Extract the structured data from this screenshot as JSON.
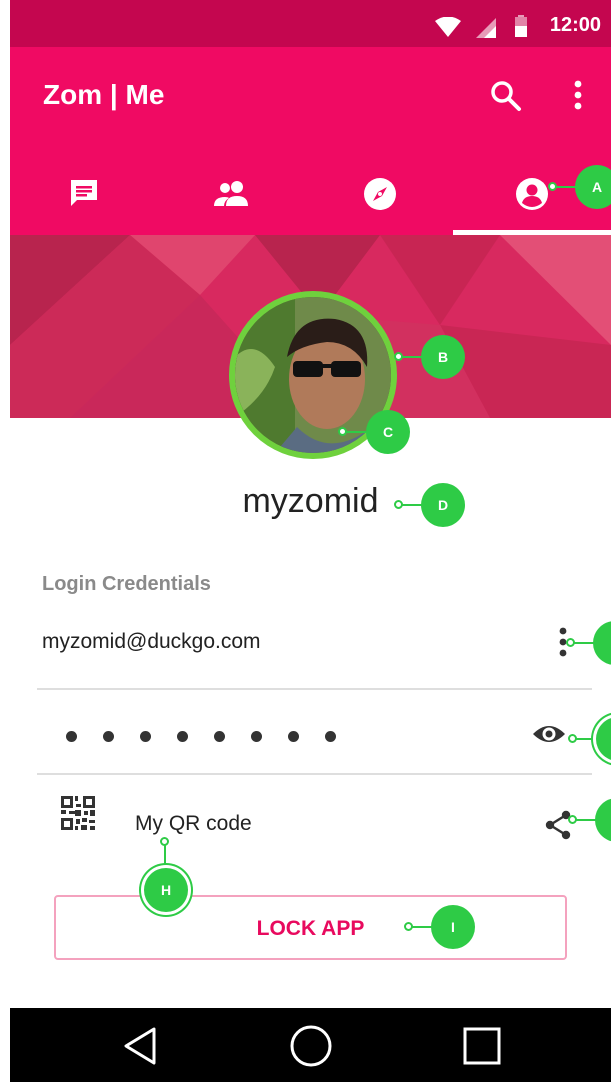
{
  "status_bar": {
    "time": "12:00"
  },
  "app_bar": {
    "title": "Zom | Me"
  },
  "tabs": [
    {
      "name": "chats",
      "icon": "chat-icon"
    },
    {
      "name": "friends",
      "icon": "people-icon"
    },
    {
      "name": "discover",
      "icon": "compass-icon"
    },
    {
      "name": "me",
      "icon": "account-icon",
      "selected": true
    }
  ],
  "profile": {
    "username": "myzomid"
  },
  "credentials": {
    "section_label": "Login Credentials",
    "email": "myzomid@duckgo.com",
    "password_dots": 8,
    "qr_label": "My QR code"
  },
  "lock_button": {
    "label": "LOCK APP"
  },
  "callouts": {
    "a": "A",
    "b": "B",
    "c": "C",
    "d": "D",
    "h": "H",
    "i": "I"
  },
  "colors": {
    "status_bar": "#c4064f",
    "app_bar": "#f00a63",
    "accent": "#e80a5e",
    "callout": "#2ecb46"
  }
}
